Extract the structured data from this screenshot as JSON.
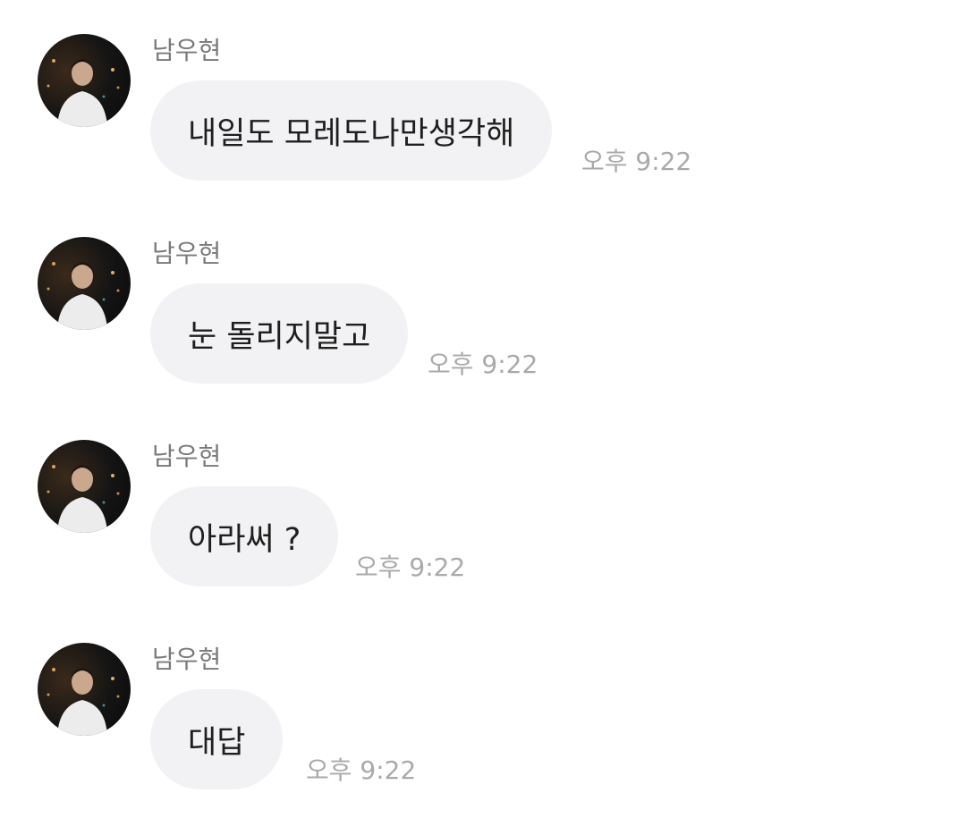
{
  "messages": [
    {
      "sender": "남우현",
      "text": "내일도 모레도나만생각해",
      "time": "오후 9:22",
      "avatar": "profile-photo"
    },
    {
      "sender": "남우현",
      "text": "눈 돌리지말고",
      "time": "오후 9:22",
      "avatar": "profile-photo"
    },
    {
      "sender": "남우현",
      "text": "아라써 ?",
      "time": "오후 9:22",
      "avatar": "profile-photo"
    },
    {
      "sender": "남우현",
      "text": "대답",
      "time": "오후 9:22",
      "avatar": "profile-photo"
    }
  ],
  "colors": {
    "bubble": "#f2f2f4",
    "sender": "#7a7a7a",
    "time": "#a9a9a9",
    "text": "#1e1e1e"
  }
}
